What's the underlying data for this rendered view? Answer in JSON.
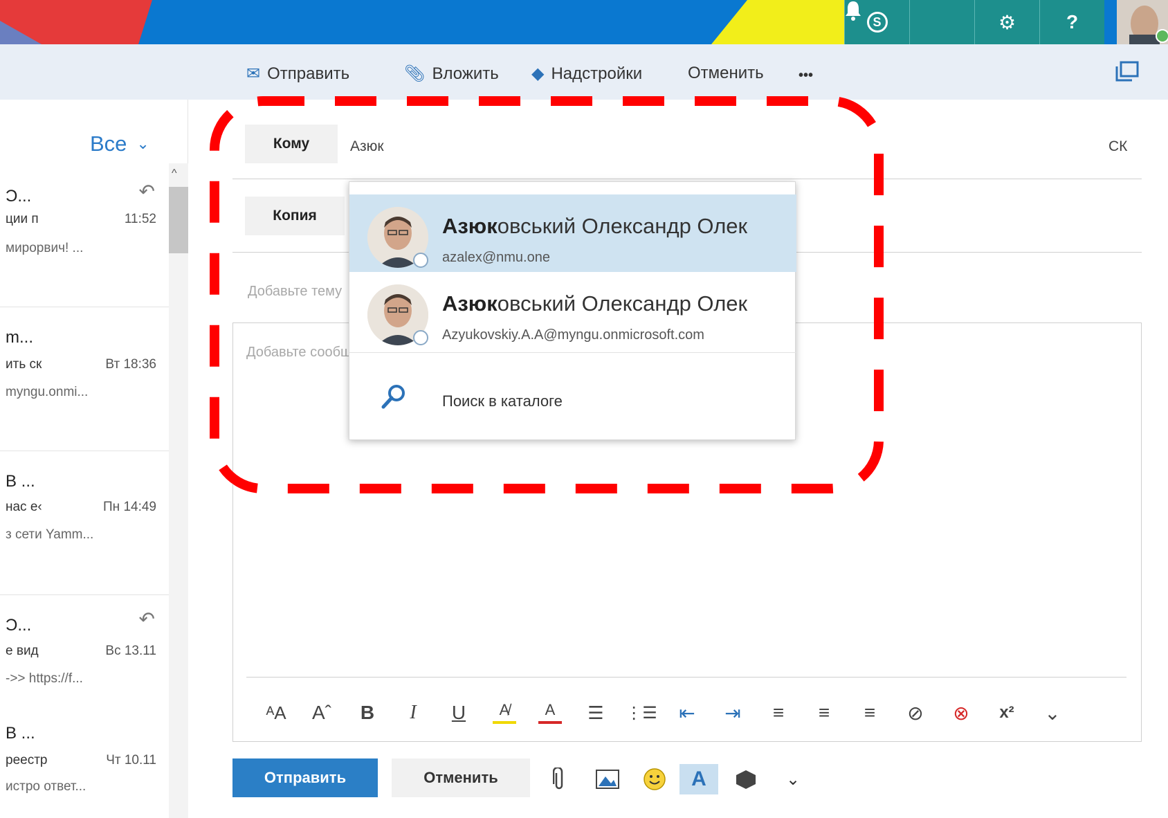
{
  "colors": {
    "banner_blue": "#0a78d0",
    "banner_red": "#e53a3a",
    "banner_yellow": "#f2ee1a",
    "banner_teal": "#1d8f8d",
    "accent": "#2b7fc6",
    "selection": "#cfe3f1",
    "highlight": "#ff0000"
  },
  "banner": {
    "icons": [
      "skype-icon",
      "bell-icon",
      "gear-icon",
      "help-icon",
      "avatar"
    ],
    "skype_glyph": "S",
    "bell_glyph": "🔔",
    "gear_glyph": "⚙",
    "help_glyph": "?"
  },
  "toolbar": {
    "send_label": "Отправить",
    "attach_label": "Вложить",
    "addins_label": "Надстройки",
    "discard_label": "Отменить",
    "more_label": "•••"
  },
  "mail_list": {
    "filter_label": "Все",
    "items": [
      {
        "sender": "Ͻ...",
        "subject": "ции п",
        "time": "11:52",
        "preview": "мирорвич! ...",
        "replied": true
      },
      {
        "sender": "m...",
        "subject": "ить ск",
        "time": "Вт 18:36",
        "preview": "myngu.onmi...",
        "replied": false
      },
      {
        "sender": "В ...",
        "subject": "нас е‹",
        "time": "Пн 14:49",
        "preview": "з сети Yamm...",
        "replied": false
      },
      {
        "sender": "Ͻ...",
        "subject": "е вид",
        "time": "Вс 13.11",
        "preview": "->> https://f...",
        "replied": true
      },
      {
        "sender": "В ...",
        "subject": "реестр",
        "time": "Чт 10.11",
        "preview": "истро ответ...",
        "replied": false
      }
    ]
  },
  "compose": {
    "to_label": "Кому",
    "to_value": "Азюк",
    "cc_label": "Копия",
    "bcc_label": "СК",
    "subject_placeholder": "Добавьте тему",
    "body_placeholder": "Добавьте сообщение"
  },
  "suggestions": {
    "items": [
      {
        "name_match": "Азюк",
        "name_rest": "овський Олександр Олек",
        "email": "azalex@nmu.one",
        "selected": true
      },
      {
        "name_match": "Азюк",
        "name_rest": "овський Олександр Олек",
        "email": "Azyukovskiy.A.A@myngu.onmicrosoft.com",
        "selected": false
      }
    ],
    "directory_search_label": "Поиск в каталоге"
  },
  "format_toolbar": {
    "buttons": [
      "font-size-icon",
      "grow-font-icon",
      "bold-icon",
      "italic-icon",
      "underline-icon",
      "highlight-icon",
      "font-color-icon",
      "bullets-icon",
      "numbering-icon",
      "outdent-icon",
      "indent-icon",
      "align-left-icon",
      "align-center-icon",
      "align-right-icon",
      "link-icon",
      "unlink-icon",
      "superscript-icon",
      "more-formatting-icon"
    ],
    "glyphs": [
      "ᴬA",
      "Aˆ",
      "B",
      "I",
      "U",
      "A̸",
      "A",
      "☰",
      "⋮☰",
      "⇤",
      "⇥",
      "≡",
      "≡",
      "≡",
      "⊘",
      "⊗",
      "x²",
      "⌄"
    ]
  },
  "bottom_bar": {
    "send_label": "Отправить",
    "discard_label": "Отменить",
    "icons": [
      "attach-icon",
      "picture-icon",
      "emoji-icon",
      "signature-icon",
      "addins-icon",
      "more-options-icon"
    ]
  }
}
